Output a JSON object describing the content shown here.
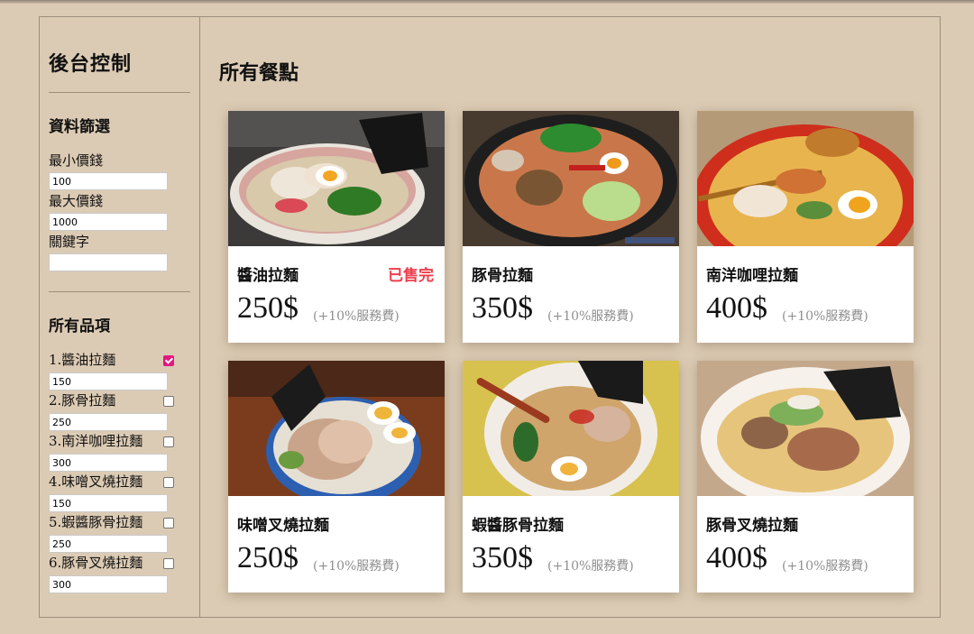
{
  "sidebar": {
    "title": "後台控制",
    "filter_title": "資料篩選",
    "min_price_label": "最小價錢",
    "min_price_value": "100",
    "max_price_label": "最大價錢",
    "max_price_value": "1000",
    "keyword_label": "關鍵字",
    "keyword_value": "",
    "items_title": "所有品項",
    "items": [
      {
        "label": "1.醬油拉麵",
        "checked": true,
        "value": "150"
      },
      {
        "label": "2.豚骨拉麵",
        "checked": false,
        "value": "250"
      },
      {
        "label": "3.南洋咖哩拉麵",
        "checked": false,
        "value": "300"
      },
      {
        "label": "4.味噌叉燒拉麵",
        "checked": false,
        "value": "150"
      },
      {
        "label": "5.蝦醬豚骨拉麵",
        "checked": false,
        "value": "250"
      },
      {
        "label": "6.豚骨叉燒拉麵",
        "checked": false,
        "value": "300"
      }
    ]
  },
  "main": {
    "title": "所有餐點",
    "cards": [
      {
        "name": "醬油拉麵",
        "price": "250$",
        "fee": "(+10%服務費)",
        "sold": "已售完"
      },
      {
        "name": "豚骨拉麵",
        "price": "350$",
        "fee": "(+10%服務費)",
        "sold": ""
      },
      {
        "name": "南洋咖哩拉麵",
        "price": "400$",
        "fee": "(+10%服務費)",
        "sold": ""
      },
      {
        "name": "味噌叉燒拉麵",
        "price": "250$",
        "fee": "(+10%服務費)",
        "sold": ""
      },
      {
        "name": "蝦醬豚骨拉麵",
        "price": "350$",
        "fee": "(+10%服務費)",
        "sold": ""
      },
      {
        "name": "豚骨叉燒拉麵",
        "price": "400$",
        "fee": "(+10%服務費)",
        "sold": ""
      }
    ]
  },
  "colors": {
    "page_background": "#dccbb4",
    "sold_out": "#ee3d4b",
    "checkbox_accent": "#e2187f",
    "fee_text": "#8f8f8f"
  }
}
